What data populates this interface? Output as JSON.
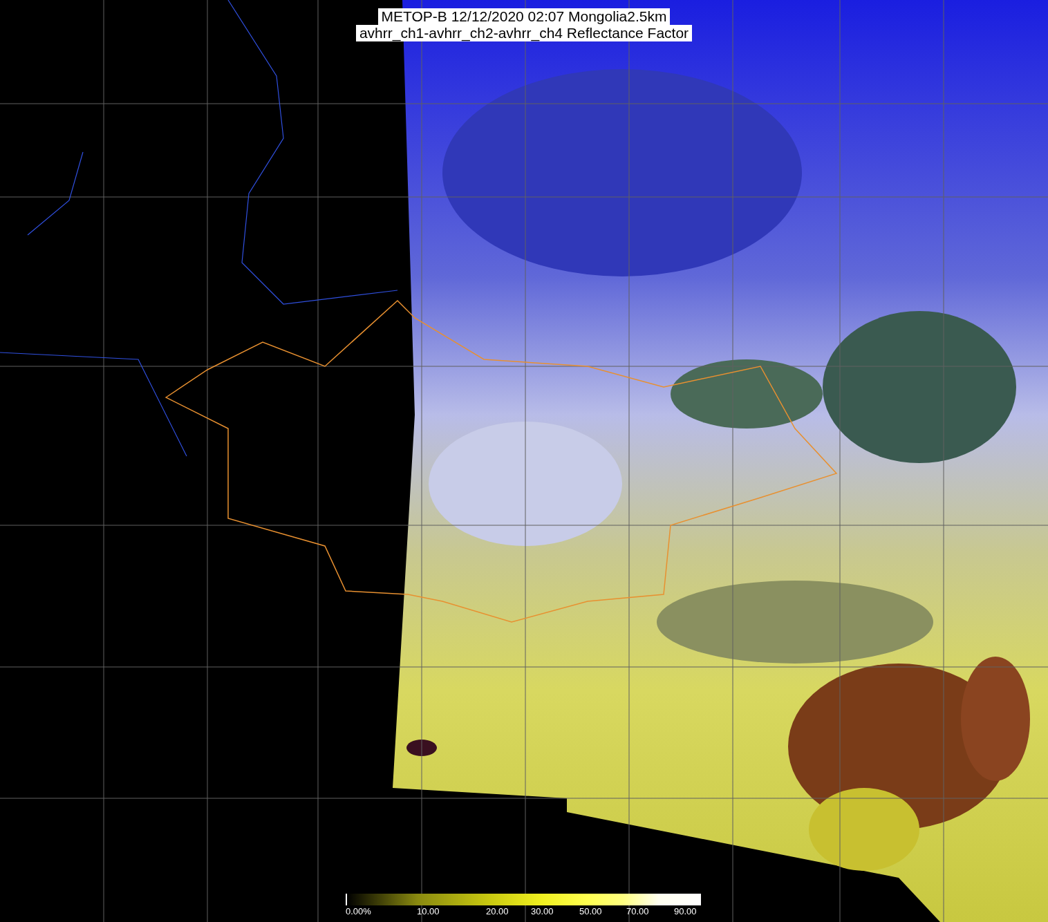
{
  "title": {
    "lines": [
      "METOP-B 12/12/2020 02:07 Mongolia2.5km",
      "avhrr_ch1-avhrr_ch2-avhrr_ch4 Reflectance Factor"
    ]
  },
  "legend": {
    "labels": [
      "0.00%",
      "10.00",
      "20.00",
      "30.00",
      "50.00",
      "70.00",
      "90.00"
    ]
  }
}
